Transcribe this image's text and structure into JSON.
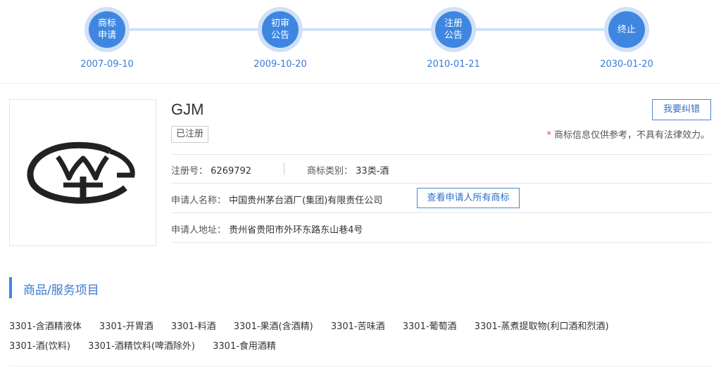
{
  "timeline": [
    {
      "label": "商标\n申请",
      "date": "2007-09-10"
    },
    {
      "label": "初审\n公告",
      "date": "2009-10-20"
    },
    {
      "label": "注册\n公告",
      "date": "2010-01-21"
    },
    {
      "label": "终止",
      "date": "2030-01-20"
    }
  ],
  "trademark": {
    "name": "GJM",
    "status": "已注册",
    "logo_text": "GJM",
    "correct_label": "我要纠错",
    "disclaimer_star": "*",
    "disclaimer": "商标信息仅供参考，不具有法律效力。",
    "reg_no_label": "注册号：",
    "reg_no": "6269792",
    "class_label": "商标类别：",
    "class_value": "33类-酒",
    "applicant_label": "申请人名称：",
    "applicant": "中国贵州茅台酒厂(集团)有限责任公司",
    "view_all_label": "查看申请人所有商标",
    "address_label": "申请人地址：",
    "address": "贵州省贵阳市外环东路东山巷4号"
  },
  "goods_section": {
    "title": "商品/服务项目",
    "items": [
      "3301-含酒精液体",
      "3301-开胃酒",
      "3301-料酒",
      "3301-果酒(含酒精)",
      "3301-苦味酒",
      "3301-葡萄酒",
      "3301-蒸煮提取物(利口酒和烈酒)",
      "3301-酒(饮料)",
      "3301-酒精饮料(啤酒除外)",
      "3301-食用酒精"
    ]
  },
  "colors": {
    "accent": "#3f86e0",
    "accent_light": "#cfe0f7",
    "warning_star": "#e04a4a"
  }
}
